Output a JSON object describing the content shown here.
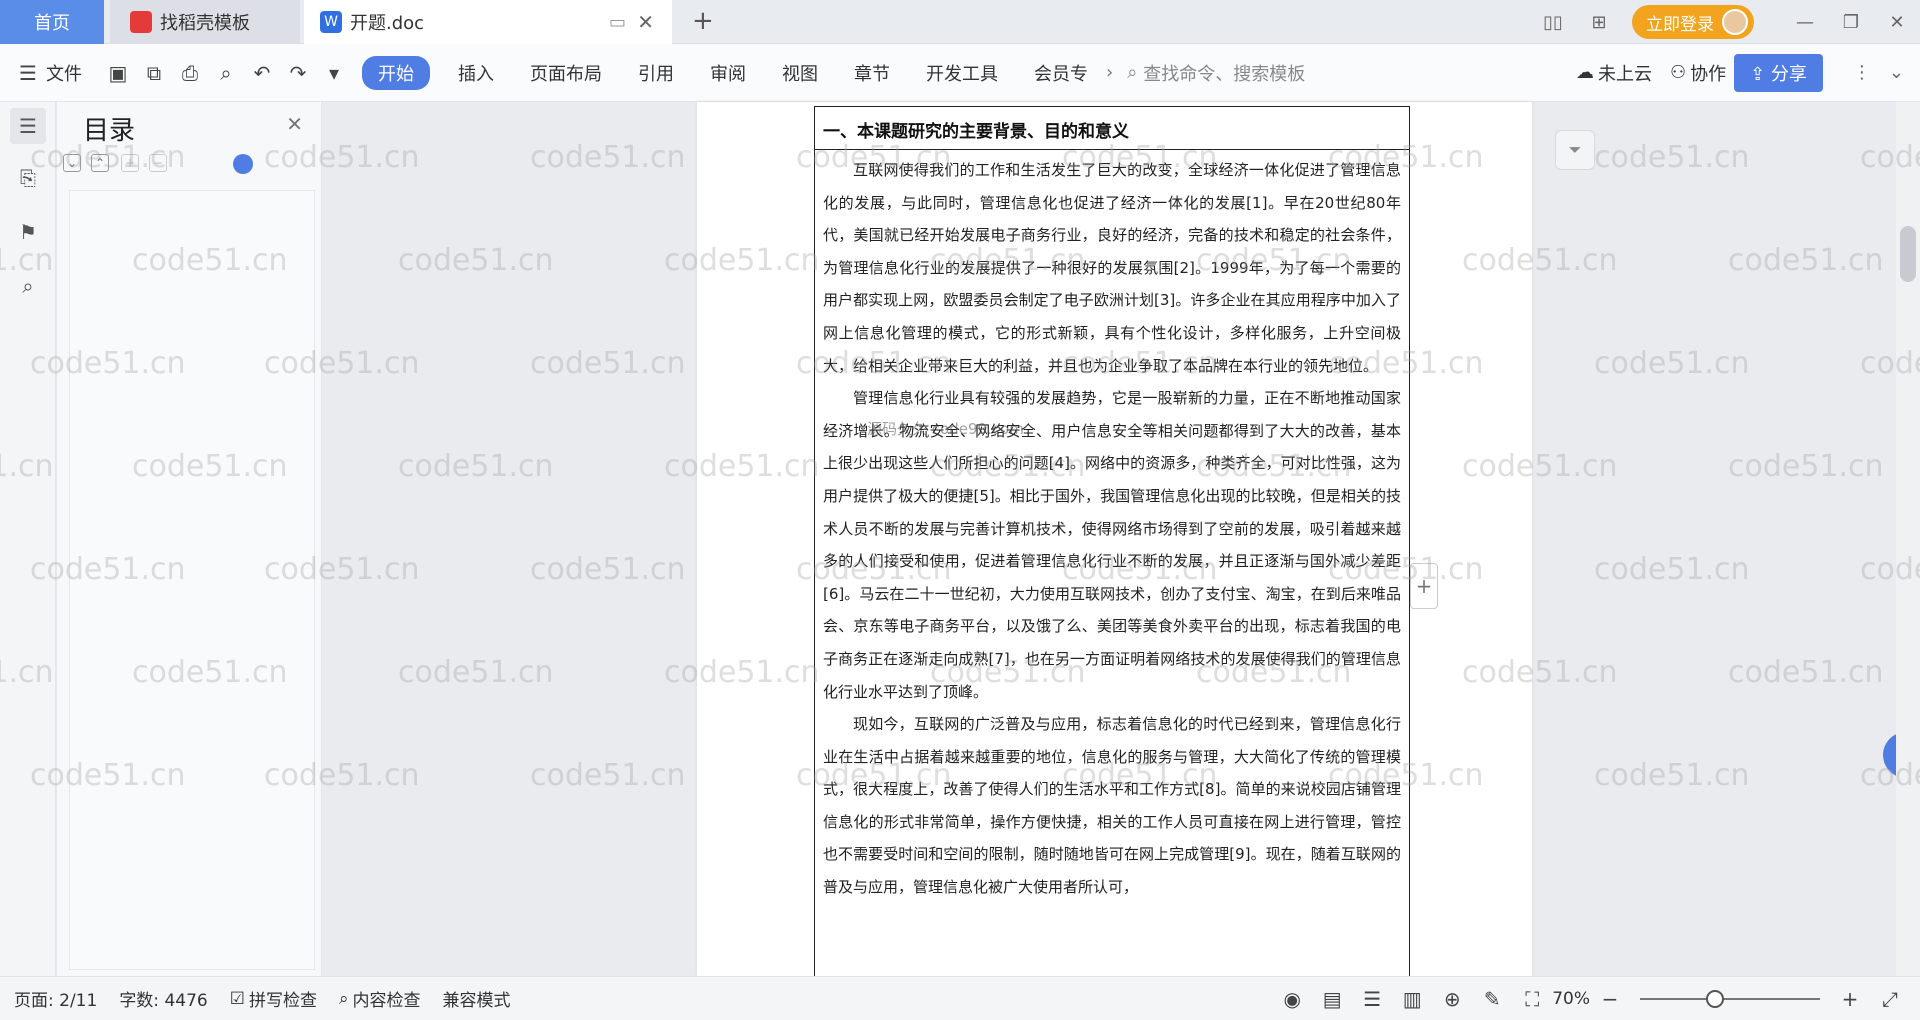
{
  "tabs": {
    "home": "首页",
    "template": "找稻壳模板",
    "doc": "开题.doc"
  },
  "topbar": {
    "login": "立即登录"
  },
  "toolbar": {
    "file": "文件",
    "menus": [
      "开始",
      "插入",
      "页面布局",
      "引用",
      "审阅",
      "视图",
      "章节",
      "开发工具",
      "会员专"
    ],
    "search_placeholder": "查找命令、搜索模板",
    "cloud": "未上云",
    "collab": "协作",
    "share": "分享"
  },
  "toc": {
    "title": "目录"
  },
  "document": {
    "heading": "一、本课题研究的主要背景、目的和意义",
    "paragraphs": [
      "互联网使得我们的工作和生活发生了巨大的改变，全球经济一体化促进了管理信息化的发展，与此同时，管理信息化也促进了经济一体化的发展[1]。早在20世纪80年代，美国就已经开始发展电子商务行业，良好的经济，完备的技术和稳定的社会条件，为管理信息化行业的发展提供了一种很好的发展氛围[2]。1999年，为了每一个需要的用户都实现上网，欧盟委员会制定了电子欧洲计划[3]。许多企业在其应用程序中加入了网上信息化管理的模式，它的形式新颖，具有个性化设计，多样化服务，上升空间极大，给相关企业带来巨大的利益，并且也为企业争取了本品牌在本行业的领先地位。",
      "管理信息化行业具有较强的发展趋势，它是一股崭新的力量，正在不断地推动国家经济增长。物流安全、网络安全、用户信息安全等相关问题都得到了大大的改善，基本上很少出现这些人们所担心的问题[4]。网络中的资源多，种类齐全，可对比性强，这为用户提供了极大的便捷[5]。相比于国外，我国管理信息化出现的比较晚，但是相关的技术人员不断的发展与完善计算机技术，使得网络市场得到了空前的发展，吸引着越来越多的人们接受和使用，促进着管理信息化行业不断的发展，并且正逐渐与国外减少差距[6]。马云在二十一世纪初，大力使用互联网技术，创办了支付宝、淘宝，在到后来唯品会、京东等电子商务平台，以及饿了么、美团等美食外卖平台的出现，标志着我国的电子商务正在逐渐走向成熟[7]，也在另一方面证明着网络技术的发展使得我们的管理信息化行业水平达到了顶峰。",
      "现如今，互联网的广泛普及与应用，标志着信息化的时代已经到来，管理信息化行业在生活中占据着越来越重要的地位，信息化的服务与管理，大大简化了传统的管理模式，很大程度上，改善了使得人们的生活水平和工作方式[8]。简单的来说校园店铺管理信息化的形式非常简单，操作方便快捷，相关的工作人员可直接在网上进行管理，管控也不需要受时间和空间的限制，随时随地皆可在网上完成管理[9]。现在，随着互联网的普及与应用，管理信息化被广大使用者所认可，"
    ],
    "overlay_watermark": "源码久久 code99.com"
  },
  "watermark": "code51.cn",
  "status": {
    "page": "页面: 2/11",
    "words": "字数: 4476",
    "spell": "拼写检查",
    "content": "内容检查",
    "compat": "兼容模式",
    "zoom": "70%"
  },
  "colors": {
    "accent": "#4f7de3",
    "login": "#f2a41e"
  }
}
